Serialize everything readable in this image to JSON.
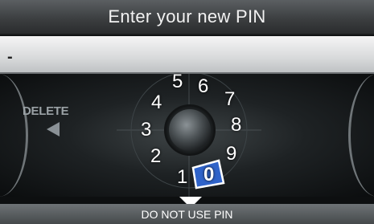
{
  "title": "Enter your new PIN",
  "pin_entry": {
    "value": "-"
  },
  "delete_control": {
    "label": "DELETE"
  },
  "dial": {
    "digits": [
      "5",
      "6",
      "7",
      "8",
      "9",
      "0",
      "1",
      "2",
      "3",
      "4"
    ],
    "selected_digit": "0"
  },
  "bottom": {
    "label": "DO NOT USE PIN"
  },
  "colors": {
    "selection": "#2f63c9",
    "selection_border": "#ffffff"
  }
}
